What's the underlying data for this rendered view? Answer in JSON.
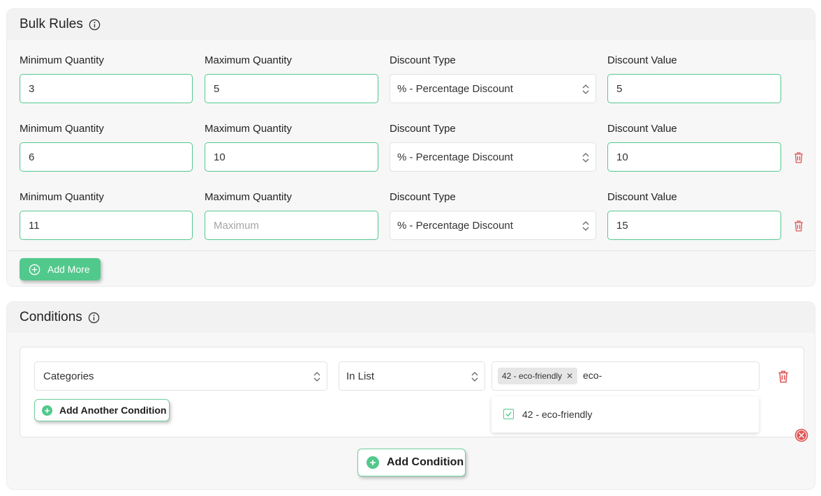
{
  "bulk_rules": {
    "title": "Bulk Rules",
    "labels": {
      "min": "Minimum Quantity",
      "max": "Maximum Quantity",
      "type": "Discount Type",
      "value": "Discount Value"
    },
    "rows": [
      {
        "min": "3",
        "max": "5",
        "type": "% - Percentage Discount",
        "value": "5"
      },
      {
        "min": "6",
        "max": "10",
        "type": "% - Percentage Discount",
        "value": "10"
      },
      {
        "min": "11",
        "max": "",
        "max_placeholder": "Maximum",
        "type": "% - Percentage Discount",
        "value": "15"
      }
    ],
    "add_more_label": "Add More"
  },
  "conditions": {
    "title": "Conditions",
    "field_select": "Categories",
    "operator_select": "In List",
    "selected_tag": "42 - eco-friendly",
    "search_text": "eco-",
    "dropdown_option": "42 - eco-friendly",
    "add_another_label": "Add Another Condition",
    "add_condition_label": "Add Condition"
  },
  "colors": {
    "accent": "#52c98c",
    "danger": "#e05555"
  },
  "icons": [
    "info-icon",
    "chevron-updown-icon",
    "trash-icon",
    "plus-circle-icon",
    "remove-tag-icon",
    "checkbox-checked-icon",
    "close-circle-icon"
  ]
}
